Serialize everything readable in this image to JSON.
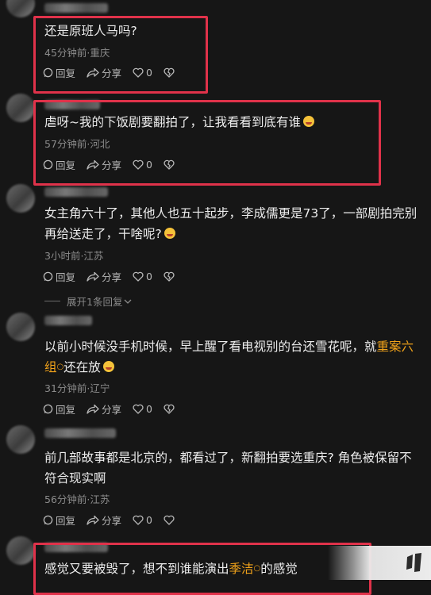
{
  "comments": [
    {
      "text": "还是原班人马吗?",
      "meta": "45分钟前·重庆",
      "reply": "回复",
      "share": "分享",
      "likes": "0"
    },
    {
      "text": "虐呀~我的下饭剧要翻拍了，让我看看到底有谁",
      "meta": "57分钟前·河北",
      "reply": "回复",
      "share": "分享",
      "likes": "0"
    },
    {
      "text": "女主角六十了，其他人也五十起步，李成儒更是73了，一部剧拍完别再给送走了，干啥呢?",
      "meta": "3小时前·江苏",
      "reply": "回复",
      "share": "分享",
      "likes": "0",
      "expand": "展开1条回复"
    },
    {
      "text_a": "以前小时候没手机时候，早上醒了看电视别的台还雪花呢，就",
      "link": "重案六组",
      "text_b": "还在放",
      "meta": "31分钟前·辽宁",
      "reply": "回复",
      "share": "分享",
      "likes": "0"
    },
    {
      "text": "前几部故事都是北京的，都看过了，新翻拍要选重庆? 角色被保留不符合现实啊",
      "meta": "56分钟前·江苏",
      "reply": "回复",
      "share": "分享",
      "likes": "0"
    },
    {
      "text_a": "感觉又要被毁了，想不到谁能演出",
      "link": "季洁",
      "text_b": "的感觉"
    }
  ],
  "icons": {
    "reply": "comment-bubble-icon",
    "share": "share-arrow-icon",
    "like": "heart-icon",
    "dislike": "broken-heart-icon"
  },
  "colors": {
    "highlight": "#e0324a",
    "link": "#f0a21a"
  }
}
